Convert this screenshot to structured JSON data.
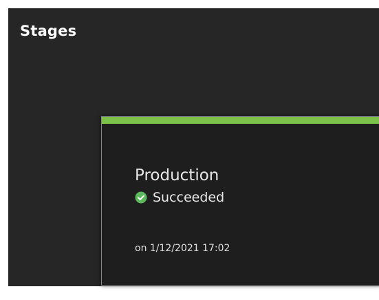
{
  "panel": {
    "title": "Stages"
  },
  "stage": {
    "name": "Production",
    "status": "Succeeded",
    "status_icon": "check-circle-icon",
    "timestamp": "on 1/12/2021 17:02",
    "accent_color": "#7bc14a",
    "status_color": "#5cb85c"
  }
}
